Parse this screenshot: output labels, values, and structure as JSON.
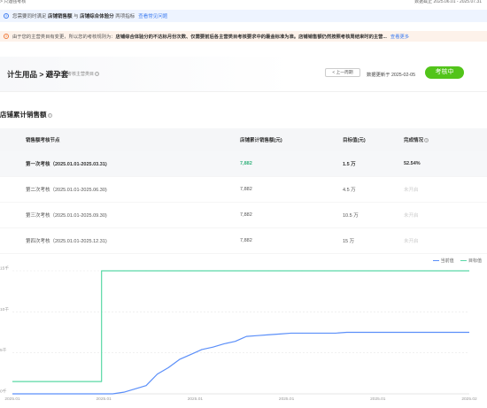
{
  "topbar": {
    "breadcrumb": "> 只遇强考核",
    "right_text": "数据截止 2025.06.01 - 2025.07.31"
  },
  "notice_blue": {
    "prefix": "您需要同时满足",
    "item1": "店铺销售额",
    "mid": "与",
    "item2": "店铺综合体验分",
    "suffix": "两项指标",
    "link": "查看常见问题"
  },
  "notice_orange": {
    "prefix": "由于您的主营类目有变更，所以您的考核规则为：",
    "text": "店铺综合体验分的不达标月份次数、仅需要前后各主营类目考核要求中的最金标准为准。店铺销售额仍然按照考核周结束时的主营...",
    "link": "查看更多"
  },
  "card": {
    "title": "计生用品 > 避孕套",
    "subtitle": "考核主营类目",
    "prev_label": "< 上一周期",
    "updated": "数据更新于 2025-02-05",
    "status": "考核中"
  },
  "section": {
    "title": "店铺累计销售额"
  },
  "table": {
    "headers": [
      "销售额考核节点",
      "店铺累计销售额(元)",
      "目标值(元)",
      "完成情况"
    ],
    "rows": [
      {
        "period": "第一次考核（2025.01.01-2025.03.31)",
        "sales": "7,882",
        "target": "1.5 万",
        "status": "52.54%"
      },
      {
        "period": "第二次考核（2025.01.01-2025.06.30)",
        "sales": "7,882",
        "target": "4.5 万",
        "status": "未开启"
      },
      {
        "period": "第三次考核（2025.01.01-2025.09.30)",
        "sales": "7,882",
        "target": "10.5 万",
        "status": "未开启"
      },
      {
        "period": "第四次考核（2025.01.01-2025.12.31)",
        "sales": "7,882",
        "target": "15 万",
        "status": "未开启"
      }
    ]
  },
  "chart_data": {
    "type": "line",
    "legend_position": "top-right",
    "x_tick_labels": [
      "2025.01",
      "2025.01",
      "2025.01",
      "2025.01",
      "2025.01",
      "2025.02"
    ],
    "y_tick_labels": [
      "0千",
      "5千",
      "10千",
      "15千"
    ],
    "ylim": [
      0,
      15000
    ],
    "series": [
      {
        "name": "当前值",
        "color": "#5b8ff9",
        "values": [
          0,
          0,
          0,
          0,
          0,
          0,
          0,
          0,
          0,
          0,
          200,
          600,
          1000,
          2400,
          3200,
          4200,
          4800,
          5400,
          5700,
          6100,
          6400,
          7000,
          7100,
          7200,
          7300,
          7400,
          7400,
          7400,
          7400,
          7400,
          7500,
          7500,
          7500,
          7500,
          7500,
          7500,
          7500,
          7500,
          7500,
          7500,
          7500,
          7500
        ]
      },
      {
        "name": "目标值",
        "color": "#5ad8a6",
        "values": [
          1500,
          1500,
          1500,
          1500,
          1500,
          1500,
          1500,
          1500,
          15000,
          15000,
          15000,
          15000,
          15000,
          15000,
          15000,
          15000,
          15000,
          15000,
          15000,
          15000,
          15000,
          15000,
          15000,
          15000,
          15000,
          15000,
          15000,
          15000,
          15000,
          15000,
          15000,
          15000,
          15000,
          15000,
          15000,
          15000,
          15000,
          15000,
          15000,
          15000,
          15000,
          15000
        ]
      }
    ]
  }
}
